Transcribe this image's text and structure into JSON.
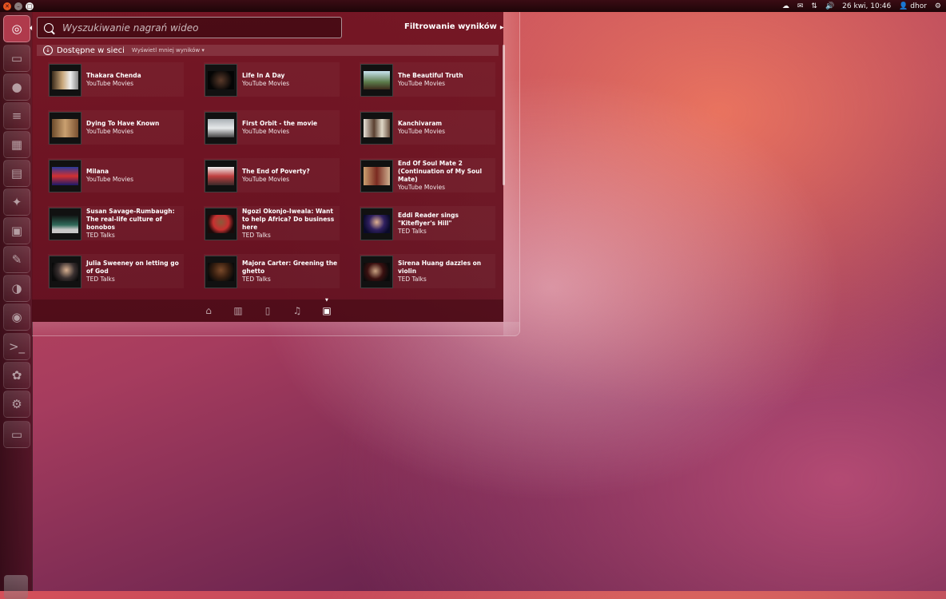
{
  "top_panel": {
    "clock": "26 kwi, 10:46",
    "user": "dhor"
  },
  "launcher": {
    "items": [
      "dash-home-icon",
      "folder-icon",
      "firefox-icon",
      "writer-icon",
      "calc-icon",
      "impress-icon",
      "software-center-icon",
      "ubuntu-one-icon",
      "settings-icon",
      "empathy-icon",
      "chat-icon",
      "terminal-icon",
      "gimp-icon",
      "system-settings-icon",
      "workspace-icon"
    ]
  },
  "dash": {
    "search_placeholder": "Wyszukiwanie nagrań wideo",
    "filter_label": "Filtrowanie wyników",
    "category_title": "Dostępne w sieci",
    "category_more": "Wyświetl mniej wyników",
    "results": [
      {
        "title": "Thakara Chenda",
        "source": "YouTube Movies"
      },
      {
        "title": "Life In A Day",
        "source": "YouTube Movies"
      },
      {
        "title": "The Beautiful Truth",
        "source": "YouTube Movies"
      },
      {
        "title": "Dying To Have Known",
        "source": "YouTube Movies"
      },
      {
        "title": "First Orbit - the movie",
        "source": "YouTube Movies"
      },
      {
        "title": "Kanchivaram",
        "source": "YouTube Movies"
      },
      {
        "title": "Milana",
        "source": "YouTube Movies"
      },
      {
        "title": "The End of Poverty?",
        "source": "YouTube Movies"
      },
      {
        "title": "End Of Soul Mate 2 (Continuation of My Soul Mate)",
        "source": "YouTube Movies"
      },
      {
        "title": "Susan Savage-Rumbaugh: The real-life culture of bonobos",
        "source": "TED Talks"
      },
      {
        "title": "Ngozi Okonjo-Iweala: Want to help Africa? Do business here",
        "source": "TED Talks"
      },
      {
        "title": "Eddi Reader sings \"Kiteflyer's Hill\"",
        "source": "TED Talks"
      },
      {
        "title": "Julia Sweeney on letting go of God",
        "source": "TED Talks"
      },
      {
        "title": "Majora Carter: Greening the ghetto",
        "source": "TED Talks"
      },
      {
        "title": "Sirena Huang dazzles on violin",
        "source": "TED Talks"
      }
    ],
    "lenses": [
      "home-lens-icon",
      "applications-lens-icon",
      "files-lens-icon",
      "music-lens-icon",
      "video-lens-icon"
    ],
    "active_lens": "video-lens-icon"
  }
}
